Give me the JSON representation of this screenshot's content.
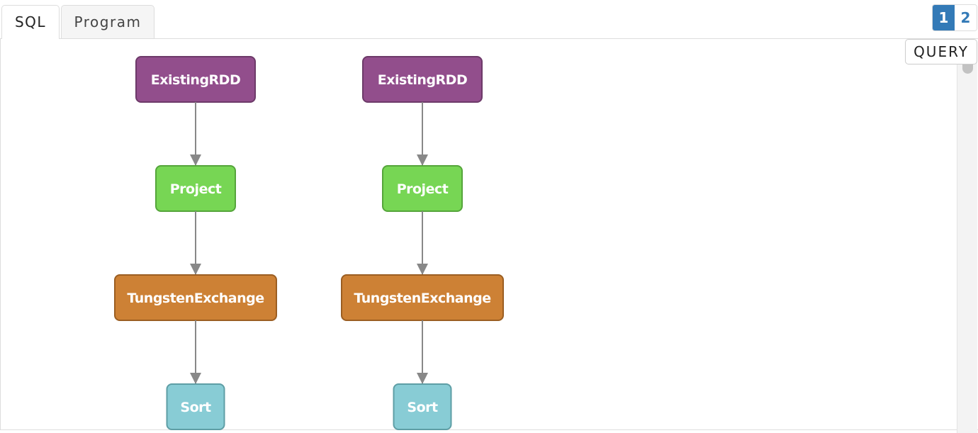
{
  "tabs": [
    {
      "label": "SQL",
      "active": true
    },
    {
      "label": "Program",
      "active": false
    }
  ],
  "pager": {
    "pages": [
      "1",
      "2"
    ],
    "current": "1"
  },
  "query_button": "QUERY",
  "node_colors": {
    "ExistingRDD": {
      "fill": "#924e8c",
      "stroke": "#6d3a69"
    },
    "Project": {
      "fill": "#77d654",
      "stroke": "#55a53b"
    },
    "TungstenExchange": {
      "fill": "#cd8135",
      "stroke": "#9b5e22"
    },
    "Sort": {
      "fill": "#88ccd5",
      "stroke": "#5e9ea5"
    }
  },
  "edge_color": "#888888",
  "graphs": [
    {
      "nodes": [
        "ExistingRDD",
        "Project",
        "TungstenExchange",
        "Sort"
      ]
    },
    {
      "nodes": [
        "ExistingRDD",
        "Project",
        "TungstenExchange",
        "Sort"
      ]
    }
  ]
}
